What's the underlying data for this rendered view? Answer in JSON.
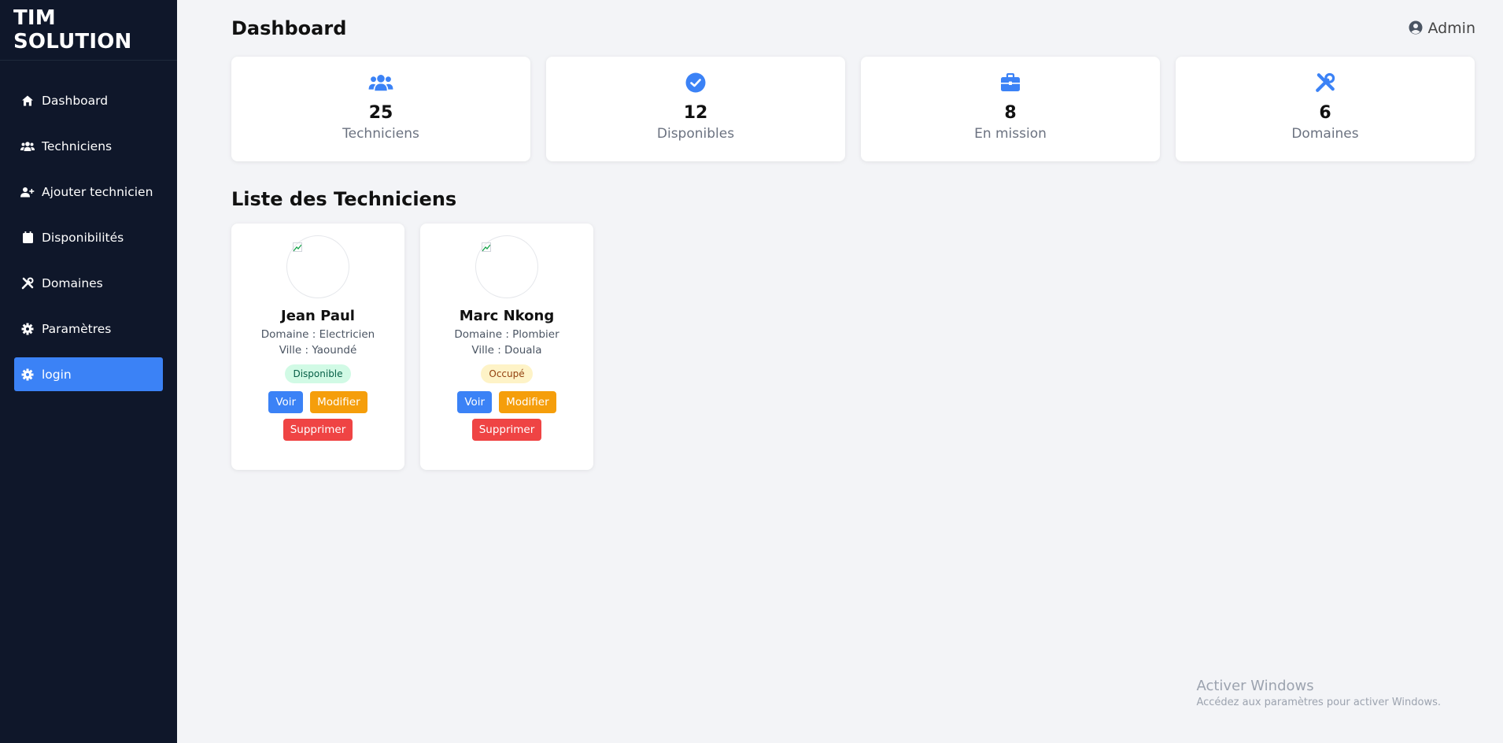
{
  "sidebar": {
    "brand": "TIM SOLUTION",
    "items": [
      {
        "label": "Dashboard",
        "icon": "home-icon"
      },
      {
        "label": "Techniciens",
        "icon": "users-icon"
      },
      {
        "label": "Ajouter technicien",
        "icon": "user-plus-icon"
      },
      {
        "label": "Disponibilités",
        "icon": "calendar-icon"
      },
      {
        "label": "Domaines",
        "icon": "tools-icon"
      },
      {
        "label": "Paramètres",
        "icon": "gear-icon"
      },
      {
        "label": "login",
        "icon": "gear-icon",
        "active": true
      }
    ]
  },
  "header": {
    "title": "Dashboard",
    "user": "Admin"
  },
  "stats": [
    {
      "value": "25",
      "label": "Techniciens",
      "icon": "users-icon"
    },
    {
      "value": "12",
      "label": "Disponibles",
      "icon": "check-circle-icon"
    },
    {
      "value": "8",
      "label": "En mission",
      "icon": "briefcase-icon"
    },
    {
      "value": "6",
      "label": "Domaines",
      "icon": "tools-icon"
    }
  ],
  "section_title": "Liste des Techniciens",
  "technicians": [
    {
      "name": "Jean Paul",
      "domain": "Domaine : Electricien",
      "city": "Ville : Yaoundé",
      "status": "Disponible",
      "view_label": "Voir",
      "edit_label": "Modifier",
      "delete_label": "Supprimer"
    },
    {
      "name": "Marc Nkong",
      "domain": "Domaine : Plombier",
      "city": "Ville : Douala",
      "status": "Occupé",
      "view_label": "Voir",
      "edit_label": "Modifier",
      "delete_label": "Supprimer"
    }
  ],
  "watermark": {
    "line1": "Activer Windows",
    "line2": "Accédez aux paramètres pour activer Windows."
  },
  "colors": {
    "sidebar_bg": "#0f172a",
    "accent": "#3b82f6",
    "warning": "#f59e0b",
    "danger": "#ef4444"
  }
}
